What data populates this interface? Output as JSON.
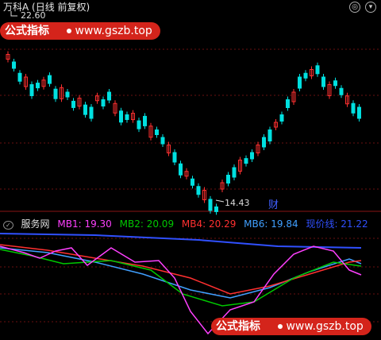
{
  "header": {
    "title": "万科A (日线 前复权)",
    "price_high": "22.60",
    "price_low": "14.43"
  },
  "badges": {
    "top_right_1": "◎",
    "top_right_2": "▾",
    "top_left_ind": "✓",
    "right_ind": "▸"
  },
  "watermark": {
    "label": "公式指标",
    "url": "www.gszb.top"
  },
  "marker": {
    "text": "财"
  },
  "indicator": {
    "name": "服务网",
    "mb1": "MB1: 19.30",
    "mb2": "MB2: 20.09",
    "mb4": "MB4: 20.29",
    "mb6": "MB6: 19.84",
    "line": "现价线: 21.22",
    "colors": {
      "mb1": "#ff40ff",
      "mb2": "#00c800",
      "mb4": "#ff3030",
      "mb6": "#40a0ff",
      "line": "#3050ff"
    }
  }
}
